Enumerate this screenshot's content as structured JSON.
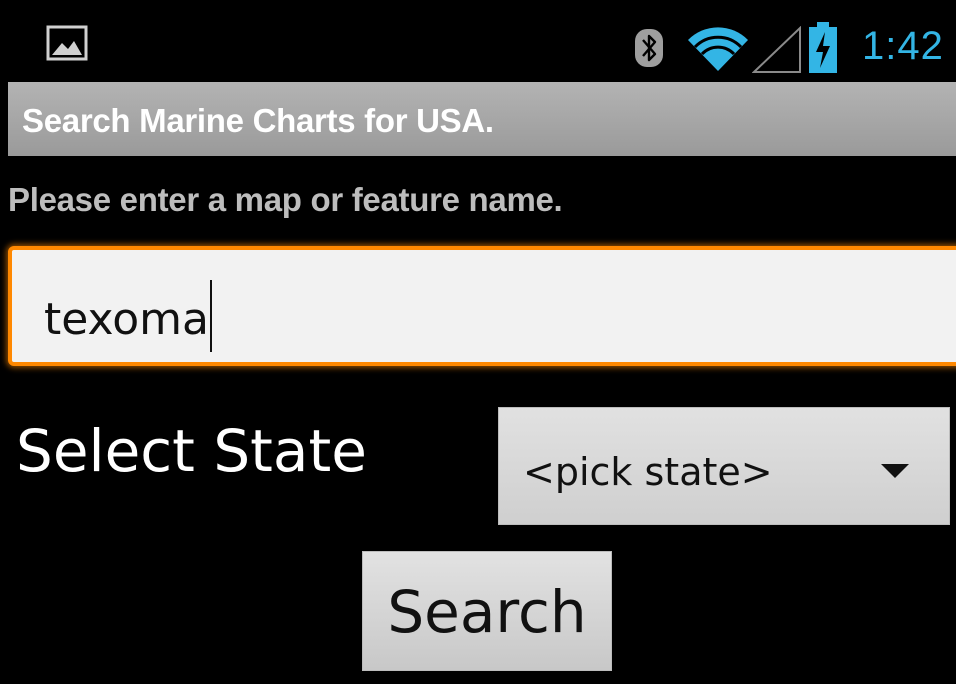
{
  "status_bar": {
    "time": "1:42",
    "icons": [
      "image-notification-icon",
      "bluetooth-icon",
      "wifi-icon",
      "cell-signal-icon",
      "battery-charging-icon"
    ],
    "clock_color": "#33b5e5"
  },
  "app": {
    "title": "Search Marine Charts for USA."
  },
  "form": {
    "prompt": "Please enter a map or feature name.",
    "search_value": "texoma",
    "state_label": "Select State",
    "state_selected": "<pick state>",
    "search_button_label": "Search"
  },
  "colors": {
    "focus_border": "#ff8800",
    "background": "#000000",
    "title_bar": "#a8a8a8"
  }
}
